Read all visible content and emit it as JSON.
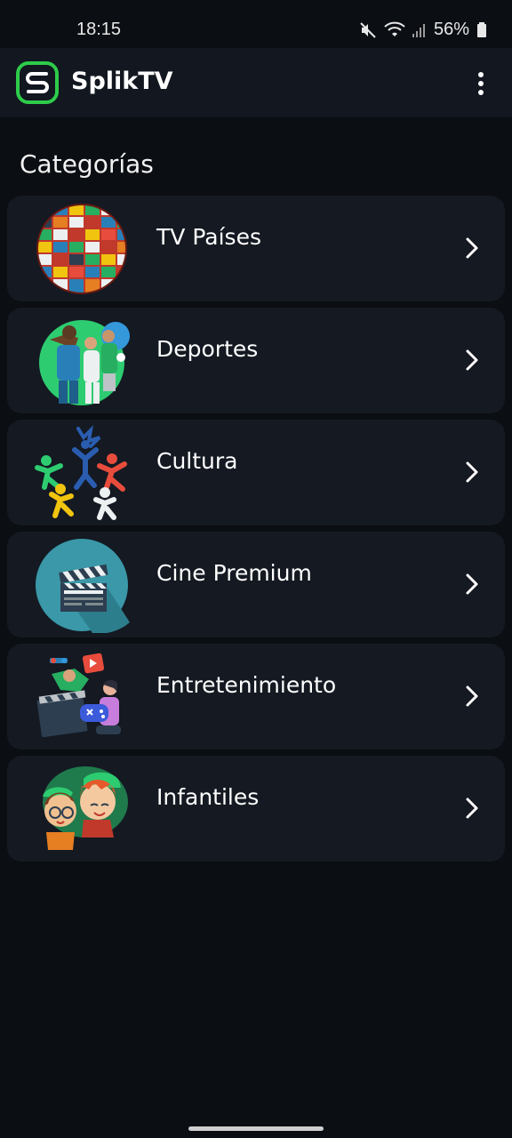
{
  "status_bar": {
    "time": "18:15",
    "battery": "56%",
    "icons": [
      "mute-icon",
      "wifi-icon",
      "signal-icon",
      "battery-icon"
    ]
  },
  "app_bar": {
    "title": "SplikTV",
    "logo_icon": "spliktv-logo-icon",
    "menu_icon": "more-vert-icon",
    "accent_color": "#2ecc4a"
  },
  "section": {
    "title": "Categorías"
  },
  "categories": [
    {
      "label": "TV Países",
      "icon": "flags-globe-icon"
    },
    {
      "label": "Deportes",
      "icon": "athletes-icon"
    },
    {
      "label": "Cultura",
      "icon": "dancers-icon"
    },
    {
      "label": "Cine Premium",
      "icon": "clapperboard-icon"
    },
    {
      "label": "Entretenimiento",
      "icon": "entertainment-icon"
    },
    {
      "label": "Infantiles",
      "icon": "kids-icon"
    }
  ],
  "colors": {
    "background": "#0b0e13",
    "card": "#141922",
    "app_bar": "#121720"
  }
}
